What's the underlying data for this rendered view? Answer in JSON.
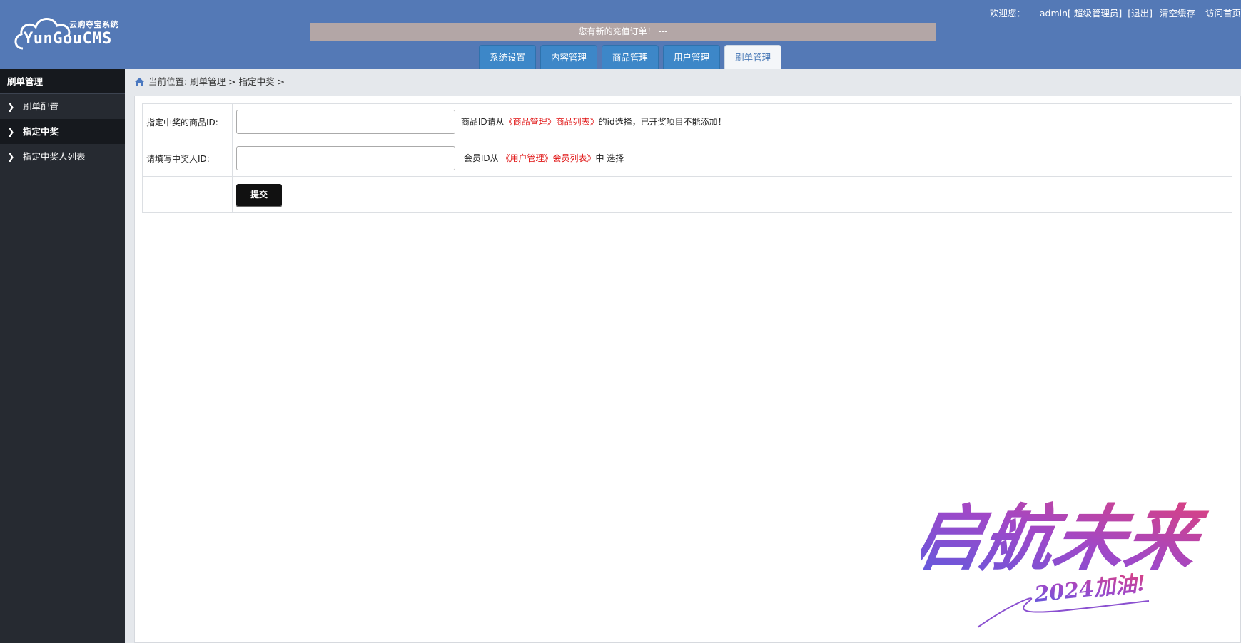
{
  "header": {
    "logo_sub": "云购夺宝系统",
    "logo_main": "YunGouCMS",
    "notice": "您有新的充值订单！ ---",
    "welcome": "欢迎您：",
    "username": "admin",
    "role": "[ 超级管理员]",
    "logout": "[退出]",
    "clear_cache": "清空缓存",
    "visit_home": "访问首页"
  },
  "tabs": [
    {
      "label": "系统设置",
      "active": false
    },
    {
      "label": "内容管理",
      "active": false
    },
    {
      "label": "商品管理",
      "active": false
    },
    {
      "label": "用户管理",
      "active": false
    },
    {
      "label": "刷单管理",
      "active": true
    }
  ],
  "sidebar": {
    "title": "刷单管理",
    "items": [
      {
        "label": "刷单配置",
        "active": false
      },
      {
        "label": "指定中奖",
        "active": true
      },
      {
        "label": "指定中奖人列表",
        "active": false
      }
    ]
  },
  "breadcrumb": "当前位置: 刷单管理 > 指定中奖 >",
  "form": {
    "product_label": "指定中奖的商品ID:",
    "product_value": "",
    "product_hint_pre": "商品ID请从",
    "product_hint_link": "《商品管理》商品列表》",
    "product_hint_post": "的id选择，已开奖项目不能添加！",
    "winner_label": "请填写中奖人ID:",
    "winner_value": "",
    "winner_hint_pre": "会员ID从",
    "winner_hint_link": "《用户管理》会员列表》",
    "winner_hint_post": "中 选择",
    "submit_label": "提交"
  },
  "decoration": {
    "headline": "启航未来",
    "tagline": "2024加油!"
  },
  "colors": {
    "header_bg": "#5479b6",
    "sidebar_bg": "#262a31",
    "tab_bg": "#3d87c8",
    "link_red": "#e01414"
  }
}
